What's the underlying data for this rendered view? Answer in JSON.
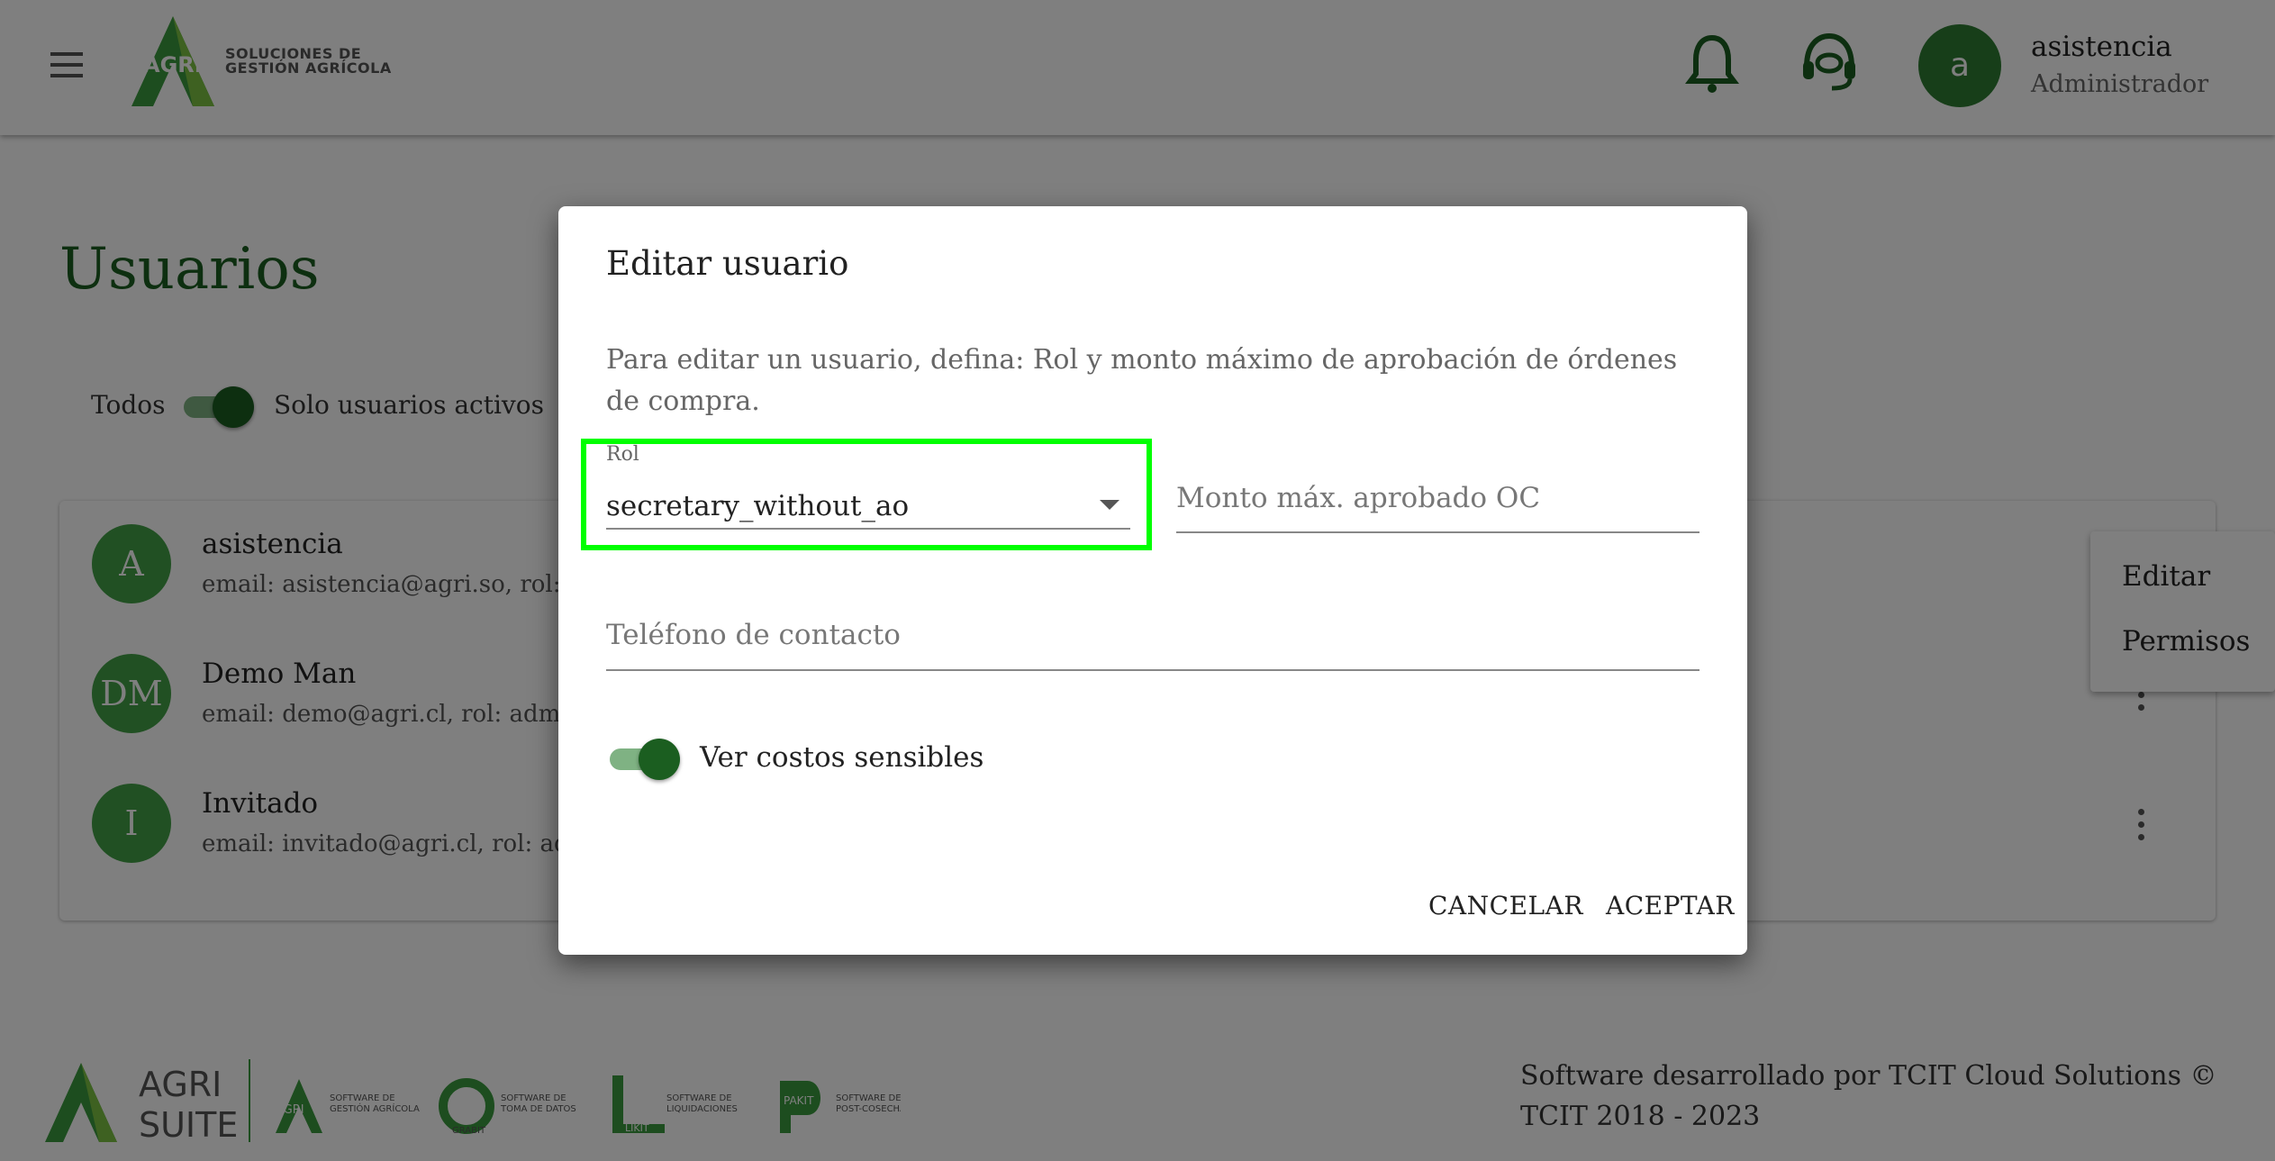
{
  "header": {
    "brand_text_line1": "SOLUCIONES DE",
    "brand_text_line2": "GESTIÓN AGRÍCOLA",
    "logo_word": "AGRI",
    "user_initial": "a",
    "user_name": "asistencia",
    "user_role": "Administrador",
    "icons": [
      "menu-icon",
      "bell-icon",
      "headset-icon"
    ]
  },
  "page": {
    "title": "Usuarios",
    "filter_all": "Todos",
    "filter_active": "Solo usuarios activos",
    "filter_active_on": true
  },
  "users": [
    {
      "initials": "A",
      "name": "asistencia",
      "detail": "email: asistencia@agri.so, rol: ad"
    },
    {
      "initials": "DM",
      "name": "Demo Man",
      "detail": "email: demo@agri.cl, rol: admin"
    },
    {
      "initials": "I",
      "name": "Invitado",
      "detail": "email: invitado@agri.cl, rol: adm"
    }
  ],
  "context_menu": {
    "edit": "Editar",
    "permissions": "Permisos"
  },
  "dialog": {
    "title": "Editar usuario",
    "description": "Para editar un usuario, defina: Rol y monto máximo de aprobación de órdenes de compra.",
    "rol_label": "Rol",
    "rol_value": "secretary_without_ao",
    "monto_placeholder": "Monto máx. aprobado OC",
    "telefono_placeholder": "Teléfono de contacto",
    "sensitive_label": "Ver costos sensibles",
    "sensitive_on": true,
    "cancel": "CANCELAR",
    "accept": "ACEPTAR"
  },
  "footer": {
    "suite_line1": "AGRI",
    "suite_line2": "SUITE",
    "products": [
      {
        "mark": "AGRI",
        "line1": "SOFTWARE DE",
        "line2": "GESTIÓN AGRÍCOLA"
      },
      {
        "mark": "GRABIT",
        "line1": "SOFTWARE DE",
        "line2": "TOMA DE DATOS"
      },
      {
        "mark": "LIKIT",
        "line1": "SOFTWARE DE",
        "line2": "LIQUIDACIONES"
      },
      {
        "mark": "PAKIT",
        "line1": "SOFTWARE DE",
        "line2": "POST-COSECHA"
      }
    ],
    "credit": "Software desarrollado por TCIT Cloud Solutions © TCIT 2018 - 2023"
  },
  "colors": {
    "primary": "#1b5e20",
    "avatar": "#43a047",
    "highlight": "#00ff00"
  }
}
